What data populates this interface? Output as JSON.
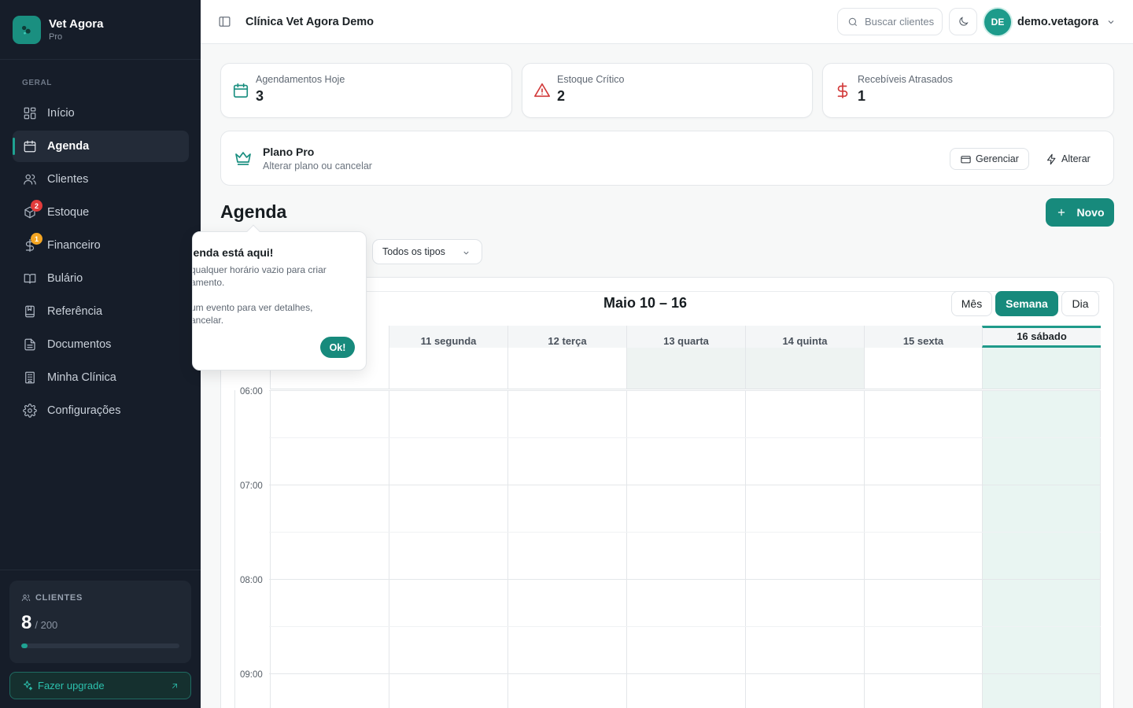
{
  "brand": {
    "name": "Vet Agora",
    "plan": "Pro"
  },
  "sidebar": {
    "section": "GERAL",
    "items": [
      {
        "label": "Início",
        "icon": "grid-icon"
      },
      {
        "label": "Agenda",
        "icon": "calendar-icon",
        "active": true
      },
      {
        "label": "Clientes",
        "icon": "users-icon"
      },
      {
        "label": "Estoque",
        "icon": "box-icon",
        "badge": "2"
      },
      {
        "label": "Financeiro",
        "icon": "dollar-icon",
        "badge": "1"
      },
      {
        "label": "Bulário",
        "icon": "book-icon"
      },
      {
        "label": "Referência",
        "icon": "bookmark-book-icon"
      },
      {
        "label": "Documentos",
        "icon": "document-icon"
      },
      {
        "label": "Minha Clínica",
        "icon": "building-icon"
      },
      {
        "label": "Configurações",
        "icon": "gear-icon"
      }
    ],
    "clients": {
      "heading": "CLIENTES",
      "count": "8",
      "total": "/ 200",
      "usage_fraction": 0.04
    },
    "upgrade_label": "Fazer upgrade"
  },
  "header": {
    "title": "Clínica Vet Agora Demo",
    "search_placeholder": "Buscar clientes",
    "avatar_initials": "DE",
    "username": "demo.vetagora"
  },
  "stats": [
    {
      "label": "Agendamentos Hoje",
      "value": "3",
      "icon": "calendar-icon",
      "color": "#1a8f80"
    },
    {
      "label": "Estoque Crítico",
      "value": "2",
      "icon": "warning-icon",
      "color": "#d23a3a"
    },
    {
      "label": "Recebíveis Atrasados",
      "value": "1",
      "icon": "dollar-icon",
      "color": "#d23a3a"
    }
  ],
  "plan": {
    "title": "Plano Pro",
    "subtitle": "Alterar plano ou cancelar",
    "manage_label": "Gerenciar",
    "change_label": "Alterar"
  },
  "agenda": {
    "title": "Agenda",
    "new_label": "Novo",
    "type_filter": "Todos os tipos",
    "range": "Maio 10 – 16",
    "views": [
      "Mês",
      "Semana",
      "Dia"
    ],
    "active_view": "Semana",
    "days": [
      "11 segunda",
      "12 terça",
      "13 quarta",
      "14 quinta",
      "15 sexta",
      "16 sábado"
    ],
    "times": [
      "06:00",
      "07:00",
      "08:00",
      "09:00"
    ]
  },
  "tooltip": {
    "title": "genda está aqui!",
    "line1": "qualquer horário vazio para criar",
    "line2": "amento.",
    "line3": "um evento para ver detalhes,",
    "line4": "ancelar.",
    "ok_label": "Ok!"
  },
  "colors": {
    "accent": "#178a7c",
    "sidebar_bg": "#161d29",
    "danger": "#d23a3a",
    "warning": "#f5a623"
  }
}
